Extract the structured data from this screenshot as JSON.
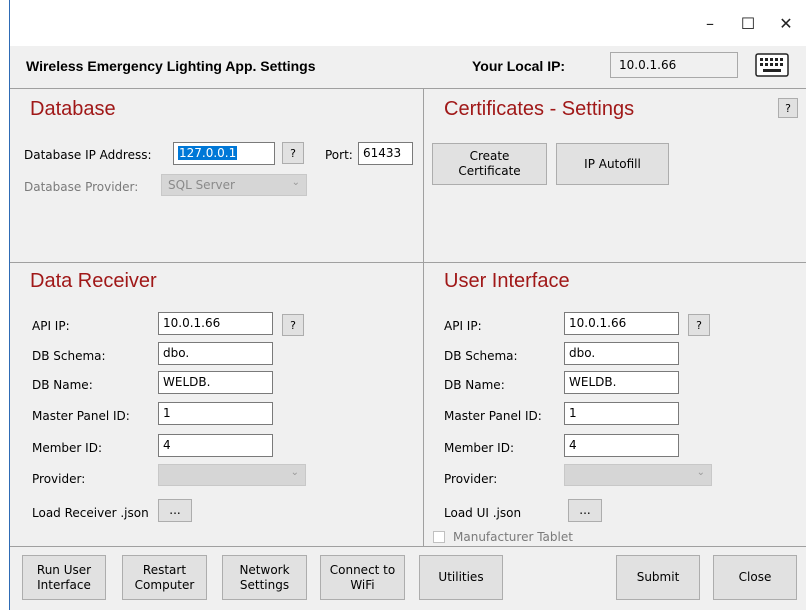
{
  "window": {
    "minimize": "–",
    "maximize": "☐",
    "close": "✕"
  },
  "header": {
    "title": "Wireless Emergency Lighting App. Settings",
    "local_ip_label": "Your Local IP:",
    "local_ip_value": "10.0.1.66",
    "keyboard_icon": "keyboard-icon"
  },
  "database": {
    "title": "Database",
    "ip_label": "Database IP Address:",
    "ip_value": "127.0.0.1",
    "help": "?",
    "port_label": "Port:",
    "port_value": "61433",
    "provider_label": "Database Provider:",
    "provider_value": "SQL Server"
  },
  "certificates": {
    "title": "Certificates - Settings",
    "help": "?",
    "create_label": "Create\nCertificate",
    "autofill_label": "IP Autofill"
  },
  "receiver": {
    "title": "Data Receiver",
    "api_ip_label": "API IP:",
    "api_ip_value": "10.0.1.66",
    "help": "?",
    "schema_label": "DB Schema:",
    "schema_value": "dbo.",
    "dbname_label": "DB Name:",
    "dbname_value": "WELDB.",
    "master_label": "Master Panel ID:",
    "master_value": "1",
    "member_label": "Member ID:",
    "member_value": "4",
    "provider_label": "Provider:",
    "load_label": "Load Receiver .json",
    "browse": "..."
  },
  "ui": {
    "title": "User Interface",
    "api_ip_label": "API  IP:",
    "api_ip_value": "10.0.1.66",
    "help": "?",
    "schema_label": "DB Schema:",
    "schema_value": "dbo.",
    "dbname_label": "DB Name:",
    "dbname_value": "WELDB.",
    "master_label": "Master Panel ID:",
    "master_value": "1",
    "member_label": "Member ID:",
    "member_value": "4",
    "provider_label": "Provider:",
    "load_label": "Load UI .json",
    "browse": "...",
    "tablet_label": "Manufacturer Tablet"
  },
  "footer": {
    "run_ui": "Run User\nInterface",
    "restart": "Restart\nComputer",
    "network": "Network\nSettings",
    "wifi": "Connect to\nWiFi",
    "utilities": "Utilities",
    "submit": "Submit",
    "close": "Close"
  },
  "colors": {
    "section_title": "#a01818",
    "window_bg": "#f0f0f0",
    "field_bg": "#ffffff",
    "disabled_bg": "#d6d6d6"
  }
}
